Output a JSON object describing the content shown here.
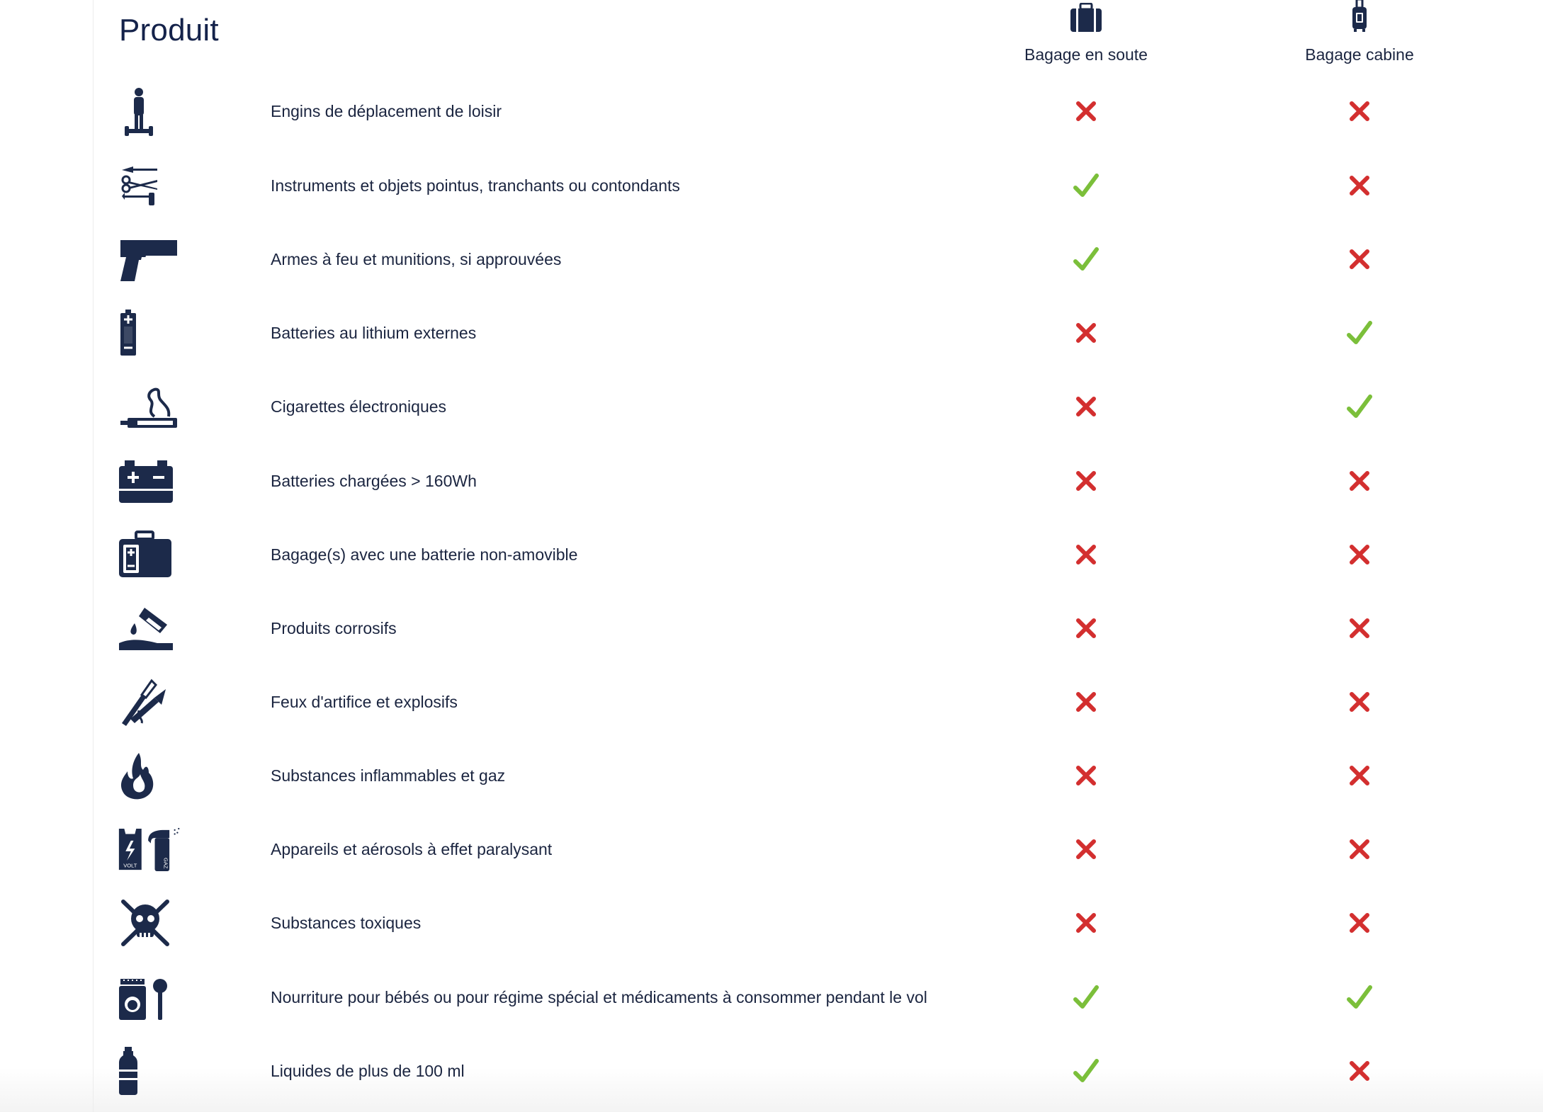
{
  "table": {
    "title": "Produit",
    "columns": [
      {
        "label": "Bagage en soute",
        "icon": "checked-suitcase-icon"
      },
      {
        "label": "Bagage cabine",
        "icon": "cabin-trolley-icon"
      }
    ],
    "rows": [
      {
        "label": "Engins de déplacement de loisir",
        "icon": "hoverboard-icon",
        "soute": "no",
        "cabine": "no"
      },
      {
        "label": "Instruments et objets pointus, tranchants ou contondants",
        "icon": "sharp-tools-icon",
        "soute": "yes",
        "cabine": "no"
      },
      {
        "label": "Armes à feu et munitions, si approuvées",
        "icon": "pistol-icon",
        "soute": "yes",
        "cabine": "no"
      },
      {
        "label": "Batteries au lithium externes",
        "icon": "lithium-battery-icon",
        "soute": "no",
        "cabine": "yes"
      },
      {
        "label": "Cigarettes électroniques",
        "icon": "e-cigarette-icon",
        "soute": "no",
        "cabine": "yes"
      },
      {
        "label": "Batteries chargées > 160Wh",
        "icon": "car-battery-icon",
        "soute": "no",
        "cabine": "no"
      },
      {
        "label": "Bagage(s) avec une batterie non-amovible",
        "icon": "smart-luggage-icon",
        "soute": "no",
        "cabine": "no"
      },
      {
        "label": "Produits corrosifs",
        "icon": "corrosive-icon",
        "soute": "no",
        "cabine": "no"
      },
      {
        "label": "Feux d'artifice et explosifs",
        "icon": "fireworks-icon",
        "soute": "no",
        "cabine": "no"
      },
      {
        "label": "Substances inflammables et gaz",
        "icon": "flame-icon",
        "soute": "no",
        "cabine": "no"
      },
      {
        "label": "Appareils et aérosols à effet paralysant",
        "icon": "taser-spray-icon",
        "soute": "no",
        "cabine": "no",
        "icon_text_1": "VOLT",
        "icon_text_2": "GAZ"
      },
      {
        "label": "Substances toxiques",
        "icon": "skull-icon",
        "soute": "no",
        "cabine": "no"
      },
      {
        "label": "Nourriture pour bébés ou pour régime spécial et médicaments à consommer pendant le vol",
        "icon": "baby-food-icon",
        "soute": "yes",
        "cabine": "yes"
      },
      {
        "label": "Liquides de plus de 100 ml",
        "icon": "bottle-icon",
        "soute": "yes",
        "cabine": "no"
      }
    ]
  },
  "colors": {
    "text": "#1b2540",
    "icon": "#1c2a4a",
    "allowed": "#7bbf3a",
    "forbidden": "#d32f2f"
  }
}
